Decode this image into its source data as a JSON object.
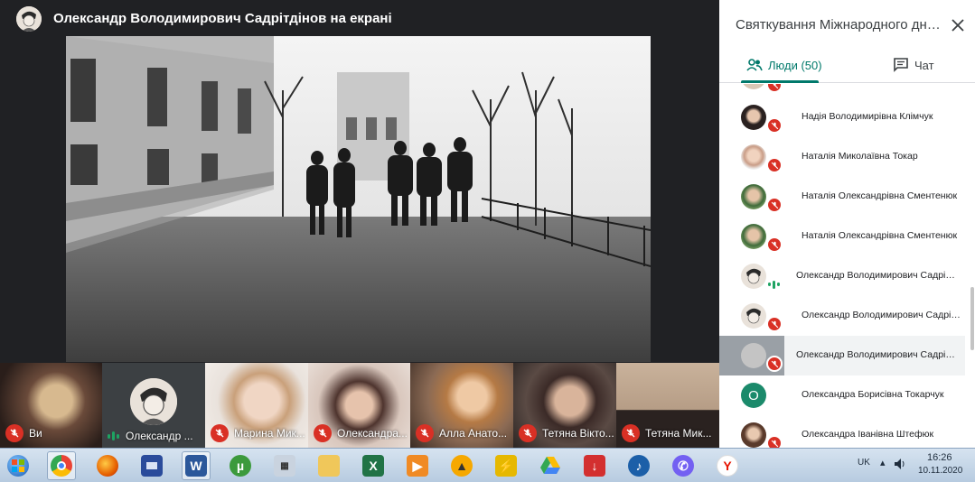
{
  "presenter": {
    "title": "Олександр Володимирович Садрітдінов на екрані"
  },
  "tiles": [
    {
      "label": "Ви",
      "mic": "muted"
    },
    {
      "label": "Олександр ...",
      "mic": "speaking"
    },
    {
      "label": "Марина Мик...",
      "mic": "muted"
    },
    {
      "label": "Олександра...",
      "mic": "muted"
    },
    {
      "label": "Алла Анато...",
      "mic": "muted"
    },
    {
      "label": "Тетяна Вікто...",
      "mic": "muted"
    },
    {
      "label": "Тетяна Мик...",
      "mic": "muted"
    }
  ],
  "panel": {
    "title": "Святкування Міжнародного дня...",
    "tab_people": "Люди (50)",
    "tab_chat": "Чат",
    "people": [
      {
        "name": "",
        "mic": "muted"
      },
      {
        "name": "Надія Володимирівна Клімчук",
        "mic": "muted"
      },
      {
        "name": "Наталія Миколаївна Токар",
        "mic": "muted"
      },
      {
        "name": "Наталія Олександрівна Сментенюк",
        "mic": "muted"
      },
      {
        "name": "Наталія Олександрівна Сментенюк",
        "mic": "muted"
      },
      {
        "name": "Олександр Володимирович Садріт...",
        "mic": "speaking"
      },
      {
        "name": "Олександр Володимирович Садріт...",
        "mic": "muted"
      },
      {
        "name": "Олександр Володимирович Садріт...",
        "mic": "muted"
      },
      {
        "name": "Олександра Борисівна Токарчук",
        "mic": "none",
        "letter": "О"
      },
      {
        "name": "Олександра Іванівна Штефюк",
        "mic": "muted"
      }
    ]
  },
  "taskbar": {
    "language": "UK",
    "time": "16:26",
    "date": "10.11.2020"
  },
  "colors": {
    "accent": "#00796b",
    "muted_red": "#d93025",
    "speaking_green": "#1ea362"
  }
}
